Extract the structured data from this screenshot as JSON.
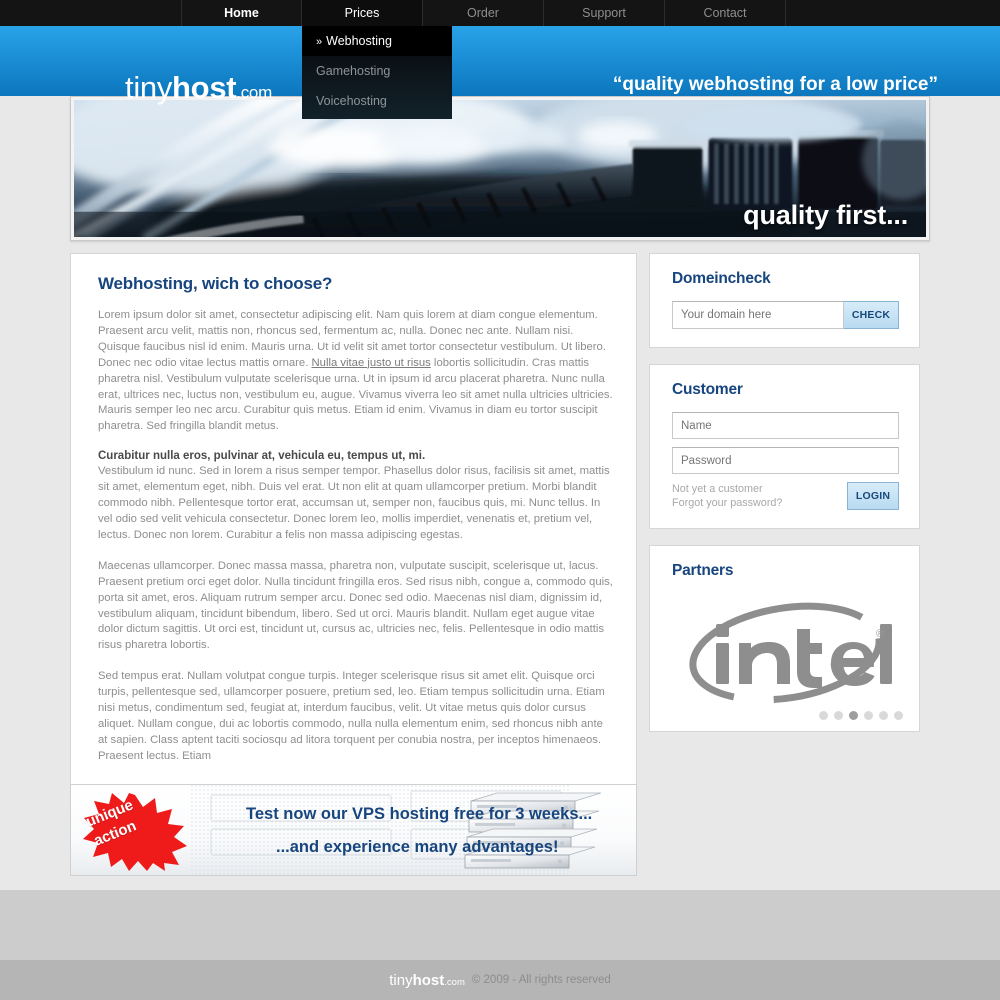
{
  "nav": {
    "items": [
      {
        "label": "Home",
        "state": "active"
      },
      {
        "label": "Prices",
        "state": "open"
      },
      {
        "label": "Order",
        "state": "normal"
      },
      {
        "label": "Support",
        "state": "normal"
      },
      {
        "label": "Contact",
        "state": "normal"
      }
    ]
  },
  "dropdown": {
    "marker": "»",
    "items": [
      {
        "label": "Webhosting",
        "selected": true
      },
      {
        "label": "Gamehosting",
        "selected": false
      },
      {
        "label": "Voicehosting",
        "selected": false
      }
    ]
  },
  "header": {
    "logo_thin": "tiny",
    "logo_bold": "host",
    "logo_domain": ".com",
    "tagline": "“quality webhosting for a low price”",
    "accent_color": "#1c8fd6"
  },
  "hero": {
    "caption": "quality first...",
    "alt": "blurred photo of network cables plugged into a switch"
  },
  "main": {
    "heading": "Webhosting, wich to choose?",
    "p1_before_link": "Lorem ipsum dolor sit amet, consectetur adipiscing elit. Nam quis lorem at diam congue elementum. Praesent arcu velit, mattis non, rhoncus sed, fermentum ac, nulla. Donec nec ante. Nullam nisi. Quisque faucibus nisl id enim. Mauris urna. Ut id velit sit amet tortor consectetur vestibulum. Ut libero. Donec nec odio vitae lectus mattis ornare. ",
    "p1_link": "Nulla vitae justo ut risus",
    "p1_after_link": " lobortis sollicitudin. Cras mattis pharetra nisl. Vestibulum vulputate scelerisque urna. Ut in ipsum id arcu placerat pharetra. Nunc nulla erat, ultrices nec, luctus non, vestibulum eu, augue. Vivamus viverra leo sit amet nulla ultricies ultricies. Mauris semper leo nec arcu. Curabitur quis metus. Etiam id enim. Vivamus in diam eu tortor suscipit pharetra. Sed fringilla blandit metus.",
    "subheading": "Curabitur nulla eros, pulvinar at, vehicula eu, tempus ut, mi.",
    "p2": "Vestibulum id nunc. Sed in lorem a risus semper tempor. Phasellus dolor risus, facilisis sit amet, mattis sit amet, elementum eget, nibh. Duis vel erat. Ut non elit at quam ullamcorper pretium. Morbi blandit commodo nibh. Pellentesque tortor erat, accumsan ut, semper non, faucibus quis, mi. Nunc tellus. In vel odio sed velit vehicula consectetur. Donec lorem leo, mollis imperdiet, venenatis et, pretium vel, lectus. Donec non lorem. Curabitur a felis non massa adipiscing egestas.",
    "p3": "Maecenas ullamcorper. Donec massa massa, pharetra non, vulputate suscipit, scelerisque ut, lacus. Praesent pretium orci eget dolor. Nulla tincidunt fringilla eros. Sed risus nibh, congue a, commodo quis, porta sit amet, eros. Aliquam rutrum semper arcu. Donec sed odio. Maecenas nisl diam, dignissim id, vestibulum aliquam, tincidunt bibendum, libero. Sed ut orci. Mauris blandit. Nullam eget augue vitae dolor dictum sagittis. Ut orci est, tincidunt ut, cursus ac, ultricies nec, felis. Pellentesque in odio mattis risus pharetra lobortis.",
    "p4": "Sed tempus erat. Nullam volutpat congue turpis. Integer scelerisque risus sit amet elit. Quisque orci turpis, pellentesque sed, ullamcorper posuere, pretium sed, leo. Etiam tempus sollicitudin urna. Etiam nisi metus, condimentum sed, feugiat at, interdum faucibus, velit. Ut vitae metus quis dolor cursus aliquet. Nullam congue, dui ac lobortis commodo, nulla nulla elementum enim, sed rhoncus nibh ante at sapien. Class aptent taciti sociosqu ad litora torquent per conubia nostra, per inceptos himenaeos. Praesent lectus. Etiam"
  },
  "domaincheck": {
    "title": "Domeincheck",
    "placeholder": "Your domain here",
    "value": "",
    "button": "CHECK"
  },
  "customer": {
    "title": "Customer",
    "name_placeholder": "Name",
    "name_value": "",
    "password_placeholder": "Password",
    "password_value": "",
    "link_register": "Not yet a customer",
    "link_forgot": "Forgot your password?",
    "button": "LOGIN"
  },
  "partners": {
    "title": "Partners",
    "logo_text": "intel",
    "logo_mark": "®",
    "dots_total": 6,
    "dot_active_index": 2
  },
  "banner": {
    "badge_line1": "unique",
    "badge_line2": "action",
    "badge_color": "#ef1b1b",
    "line1": "Test now our VPS hosting free for 3 weeks...",
    "line2": "...and experience many advantages!"
  },
  "footer": {
    "logo_thin": "tiny",
    "logo_bold": "host",
    "logo_domain": ".com",
    "copyright": "© 2009 - All rights reserved"
  }
}
